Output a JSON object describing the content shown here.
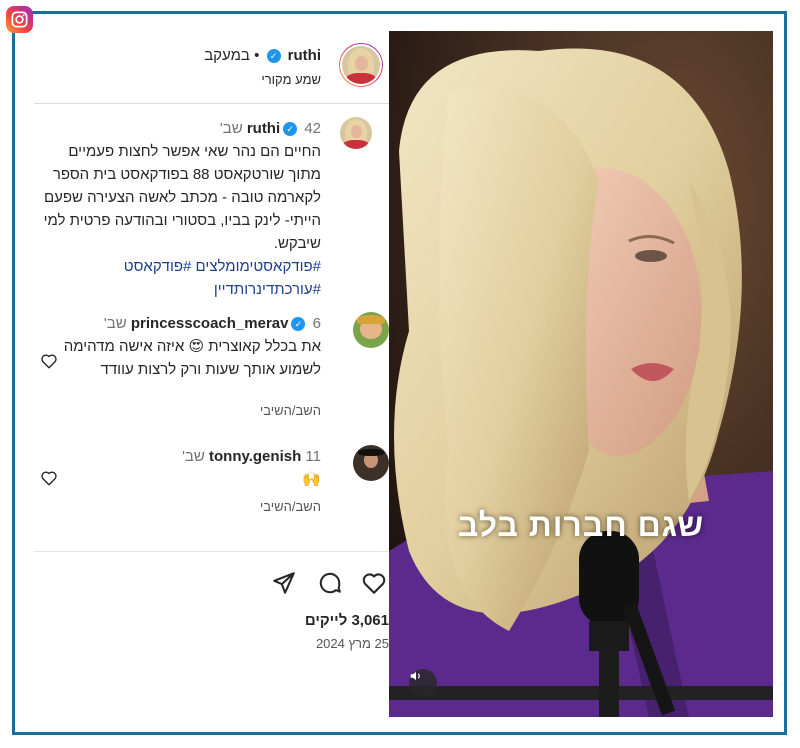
{
  "header": {
    "username": "ruthi",
    "separator": "•",
    "follow_status": "במעקב",
    "audio": "שמע מקורי"
  },
  "post": {
    "username": "ruthi",
    "time": "42 שב'",
    "text": "החיים הם נהר שאי אפשר לחצות פעמיים מתוך שורטקאסט 88 בפודקאסט בית הספר לקארמה טובה - מכתב לאשה הצעירה שפעם הייתי- לינק בביו, בסטורי ובהודעה פרטית למי שיבקש.",
    "hashtags_line1": "#פודקאסטימומלצים #פודקאסט",
    "hashtags_line2": "#עורכתדינרותדיין"
  },
  "comments": [
    {
      "username": "princesscoach_merav",
      "time": "6 שב'",
      "text_part1": "את בכלל קאוצרית",
      "emoji": "😍",
      "text_part2": "איזה אישה מדהימה לשמוע אותך שעות ורק לרצות עוודד",
      "reply_label": "השב/השיבי"
    },
    {
      "username": "tonny.genish",
      "time": "11 שב'",
      "text": "🙌",
      "reply_label": "השב/השיבי"
    }
  ],
  "actions": {
    "likes": "3,061 לייקים",
    "date": "25 מרץ 2024"
  },
  "video": {
    "overlay_text": "שגם חברות בלב"
  },
  "icons": {
    "instagram_logo": "instagram-icon",
    "like": "heart-icon",
    "comment": "comment-icon",
    "share": "send-icon",
    "sound": "speaker-icon",
    "verified": "verified-badge-icon"
  },
  "colors": {
    "frame_border": "#1d6f9b",
    "verified": "#1e96f0",
    "hashtag": "#1d3f8c",
    "overlay_shirt": "#5b2a8c"
  }
}
